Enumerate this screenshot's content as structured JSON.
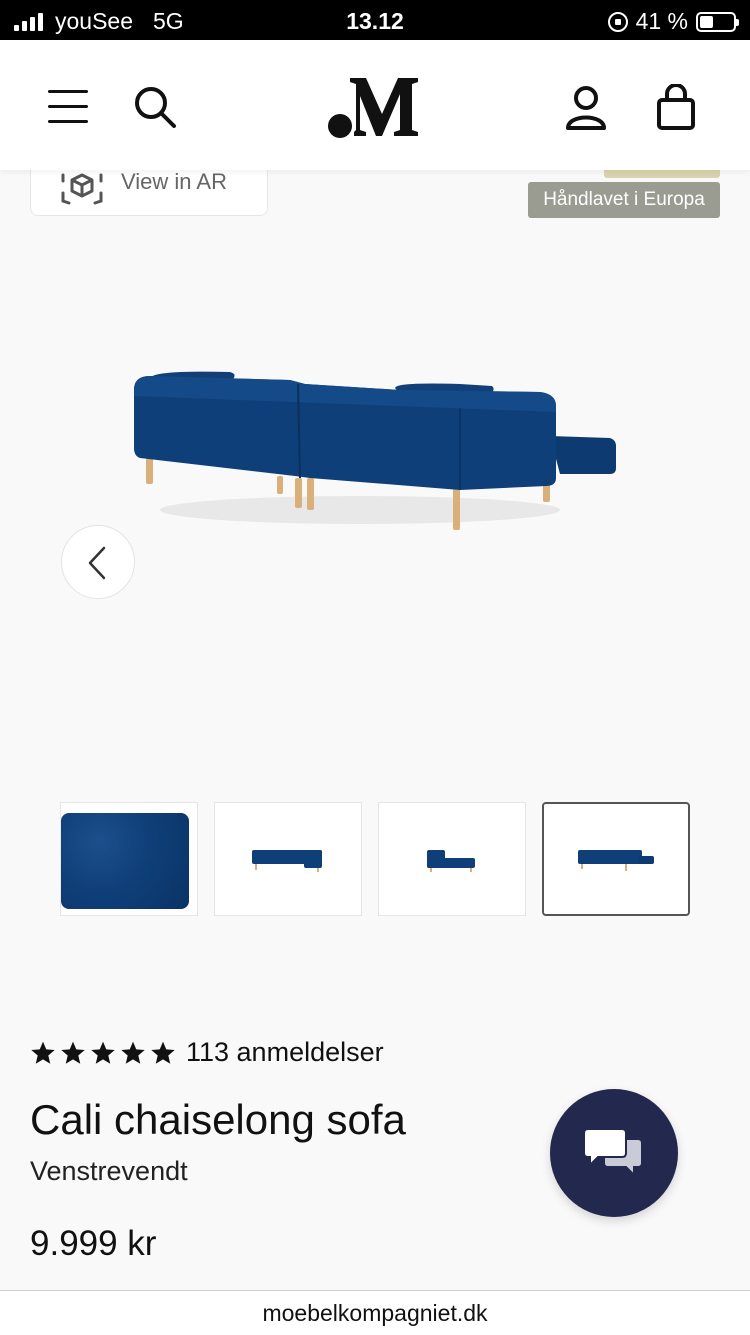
{
  "status_bar": {
    "carrier": "youSee",
    "network": "5G",
    "time": "13.12",
    "battery_text": "41 %",
    "battery_level": 0.41
  },
  "header": {
    "icons": [
      "menu-icon",
      "search-icon",
      "brand-logo",
      "account-icon",
      "shopping-bag-icon"
    ]
  },
  "gallery": {
    "ar_label": "View in AR",
    "badge": "Håndlavet i Europa",
    "thumbnails": [
      "fabric-swatch",
      "sofa-front",
      "sofa-side",
      "sofa-back"
    ],
    "active_thumbnail": 3,
    "sofa_color": "#0f3f78"
  },
  "product": {
    "rating_stars": 5,
    "reviews": "113 anmeldelser",
    "title": "Cali chaiselong sofa",
    "variant": "Venstrevendt",
    "price": "9.999 kr"
  },
  "colors": {
    "chat_button": "#23284e",
    "badge_bg": "#9a9c92",
    "sofa_blue": "#0f3f78"
  },
  "browser": {
    "url": "moebelkompagniet.dk"
  }
}
